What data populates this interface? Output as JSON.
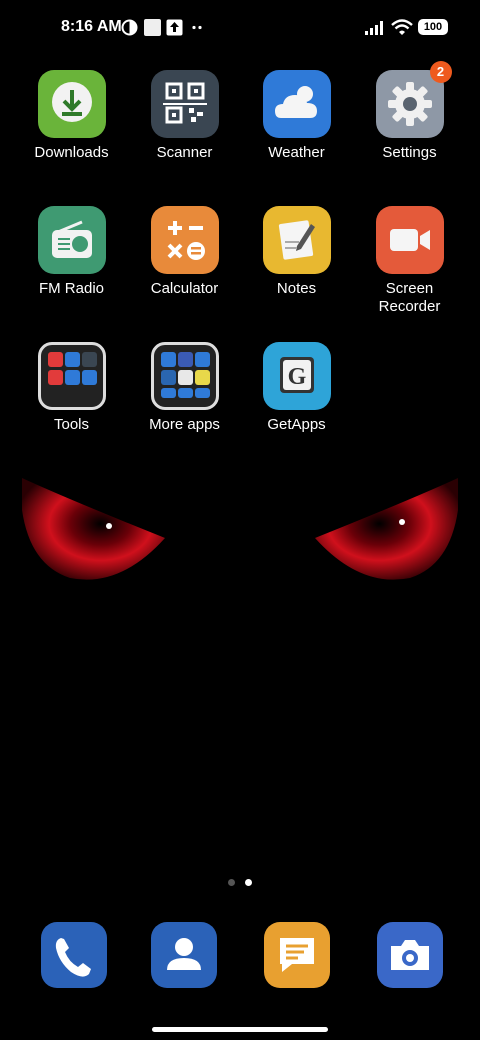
{
  "status_bar": {
    "time": "8:16 AM",
    "battery": "100",
    "icons": [
      "privacy-icon",
      "app-notification-icon",
      "upload-icon",
      "more-dots-icon",
      "signal-icon",
      "wifi-icon",
      "battery-icon"
    ]
  },
  "apps": [
    {
      "label": "Downloads",
      "icon": "download-icon",
      "color": "#6ab43a"
    },
    {
      "label": "Scanner",
      "icon": "qr-code-icon",
      "color": "#3a4652"
    },
    {
      "label": "Weather",
      "icon": "cloud-sun-icon",
      "color": "#2f7ad8"
    },
    {
      "label": "Settings",
      "icon": "gear-icon",
      "color": "#8e98a6",
      "badge": "2"
    },
    {
      "label": "FM Radio",
      "icon": "radio-icon",
      "color": "#3f9a72"
    },
    {
      "label": "Calculator",
      "icon": "calculator-icon",
      "color": "#e88a3a"
    },
    {
      "label": "Notes",
      "icon": "notes-icon",
      "color": "#e8b830"
    },
    {
      "label": "Screen\nRecorder",
      "icon": "video-camera-icon",
      "color": "#e45a3a"
    },
    {
      "label": "Tools",
      "icon": "folder-icon",
      "color": "#222222"
    },
    {
      "label": "More apps",
      "icon": "folder-icon",
      "color": "#222222"
    },
    {
      "label": "GetApps",
      "icon": "getapps-icon",
      "color": "#2ea4d8"
    }
  ],
  "dock": [
    {
      "name": "phone",
      "icon": "phone-icon",
      "color": "#2b62b8"
    },
    {
      "name": "contacts",
      "icon": "contacts-icon",
      "color": "#2b62b8"
    },
    {
      "name": "messages",
      "icon": "message-icon",
      "color": "#e8a030"
    },
    {
      "name": "camera",
      "icon": "camera-icon",
      "color": "#3a68c8"
    }
  ],
  "page_indicator": {
    "pages": 2,
    "current": 2
  },
  "wallpaper": {
    "accent": "#c8101a"
  }
}
